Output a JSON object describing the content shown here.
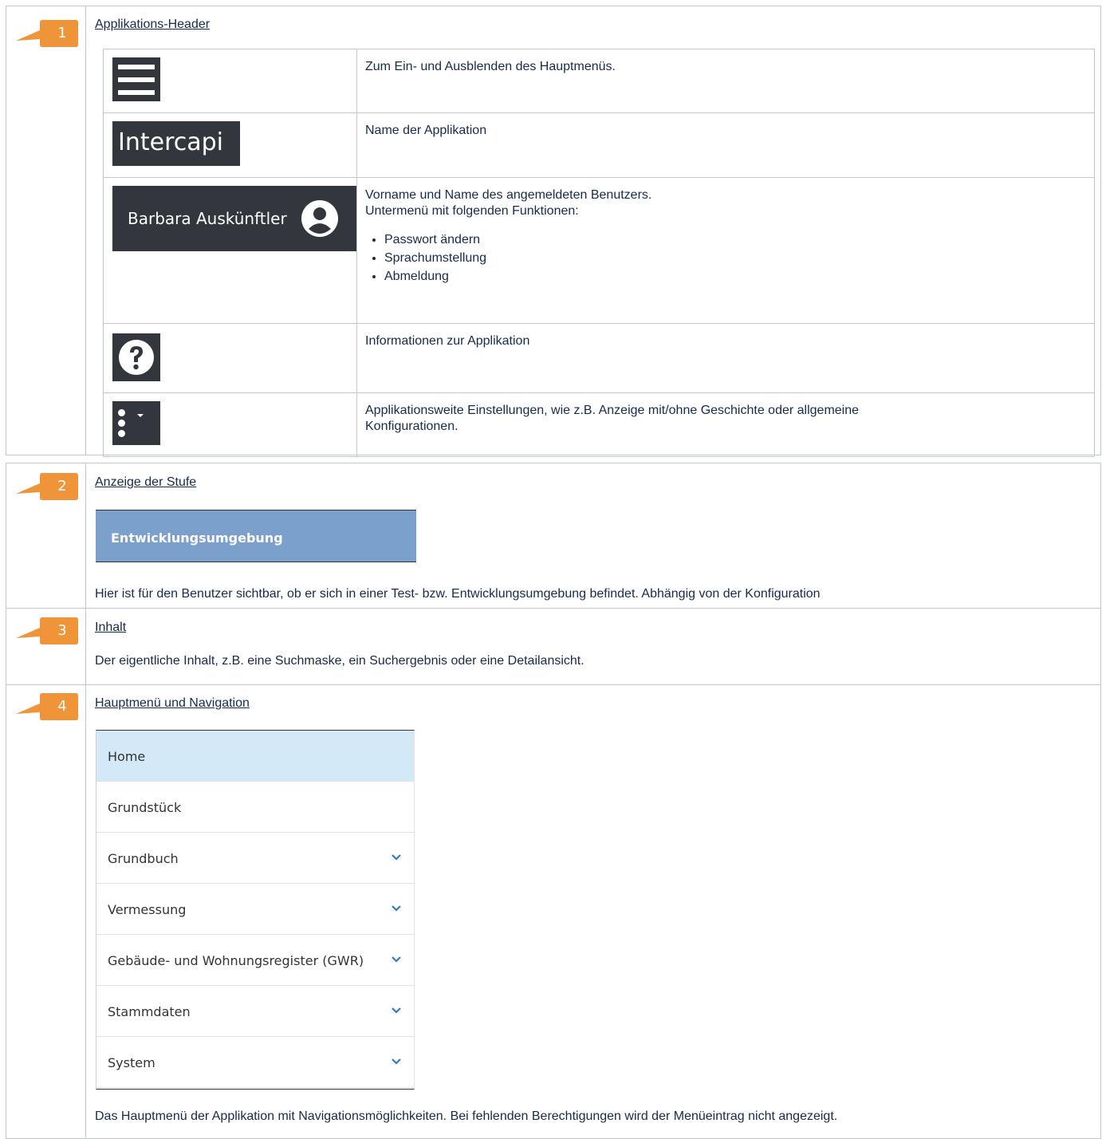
{
  "sections": [
    {
      "number": "1",
      "title": "Applikations-Header",
      "rows": [
        {
          "icon": "hamburger-menu-icon",
          "text": "Zum Ein- und Ausblenden des Hauptmenüs."
        },
        {
          "icon": "app-name-label",
          "label": "Intercapi",
          "text": "Name der Applikation"
        },
        {
          "icon": "user-menu",
          "label": "Barbara Auskünftler",
          "text": "Vorname und Name des angemeldeten Benutzers.",
          "text2": "Untermenü mit folgenden Funktionen:",
          "items": [
            "Passwort ändern",
            "Sprachumstellung",
            "Abmeldung"
          ]
        },
        {
          "icon": "help-icon",
          "text": "Informationen zur Applikation"
        },
        {
          "icon": "more-vertical-icon",
          "text": "Applikationsweite Einstellungen, wie z.B. Anzeige mit/ohne Geschichte oder allgemeine",
          "text2": "Konfigurationen."
        }
      ]
    },
    {
      "number": "2",
      "title": "Anzeige der Stufe",
      "banner": "Entwicklungsumgebung",
      "text": "Hier ist für den Benutzer sichtbar, ob er sich in einer Test- bzw. Entwicklungsumgebung befindet. Abhängig von der Konfiguration"
    },
    {
      "number": "3",
      "title": "Inhalt",
      "text": "Der eigentliche Inhalt, z.B. eine Suchmaske, ein Suchergebnis oder eine Detailansicht."
    },
    {
      "number": "4",
      "title": "Hauptmenü und Navigation",
      "menu": [
        "Home",
        "Grundstück",
        "Grundbuch",
        "Vermessung",
        "Gebäude- und Wohnungsregister (GWR)",
        "Stammdaten",
        "System"
      ],
      "text": "Das Hauptmenü der Applikation mit Navigationsmöglichkeiten. Bei fehlenden Berechtigungen wird der Menüeintrag nicht angezeigt."
    }
  ],
  "colors": {
    "callout": "#f0943a",
    "dark": "#33373d",
    "banner": "#7aa0cb",
    "menu_active": "#d4e9f7",
    "chevron": "#2a7bd4"
  }
}
